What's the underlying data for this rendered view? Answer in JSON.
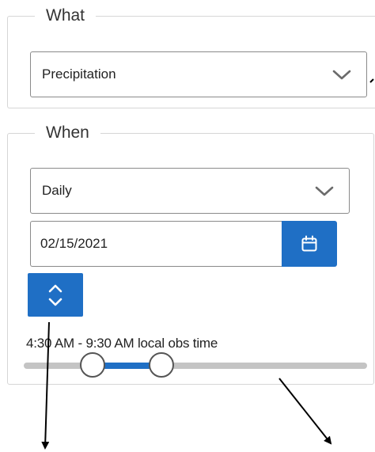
{
  "what": {
    "legend": "What",
    "selected": "Precipitation"
  },
  "when": {
    "legend": "When",
    "frequency_selected": "Daily",
    "date_value": "02/15/2021",
    "obs_time_label": "4:30 AM - 9:30 AM local obs time",
    "slider": {
      "range_start_fraction": 0.2,
      "range_end_fraction": 0.4
    }
  },
  "icons": {
    "select_chevron": "chevron-down-icon",
    "calendar": "calendar-icon",
    "stepper": "up-down-chevron-icon"
  },
  "colors": {
    "accent": "#1f6fc5",
    "track": "#c4c4c4",
    "border": "#8a8a8a"
  }
}
